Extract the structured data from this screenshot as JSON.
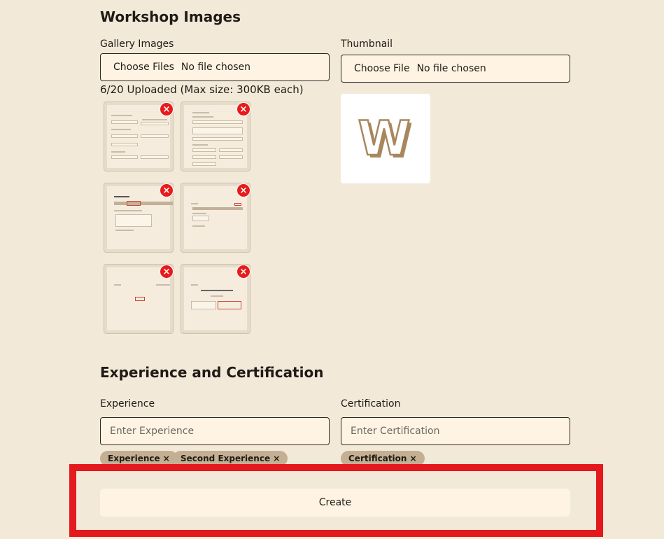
{
  "workshop_images": {
    "title": "Workshop Images",
    "gallery": {
      "label": "Gallery Images",
      "choose_label": "Choose Files",
      "status": "No file chosen",
      "uploaded_text": "6/20 Uploaded (Max size: 300KB each)",
      "remove_glyph": "×"
    },
    "thumbnail": {
      "label": "Thumbnail",
      "choose_label": "Choose File",
      "status": "No file chosen",
      "preview_letter": "W"
    }
  },
  "experience_certification": {
    "title": "Experience and Certification",
    "experience": {
      "label": "Experience",
      "placeholder": "Enter Experience",
      "tags": [
        "Experience ×",
        "Second Experience ×"
      ]
    },
    "certification": {
      "label": "Certification",
      "placeholder": "Enter Certification",
      "tags": [
        "Certification ×"
      ]
    }
  },
  "actions": {
    "create_label": "Create"
  },
  "colors": {
    "background": "#f3e9d9",
    "input_bg": "#fff4e3",
    "tag_bg": "#c4af93",
    "remove_red": "#e81b1b",
    "highlight_red": "#e3191e",
    "logo_brown": "#a8875d"
  }
}
